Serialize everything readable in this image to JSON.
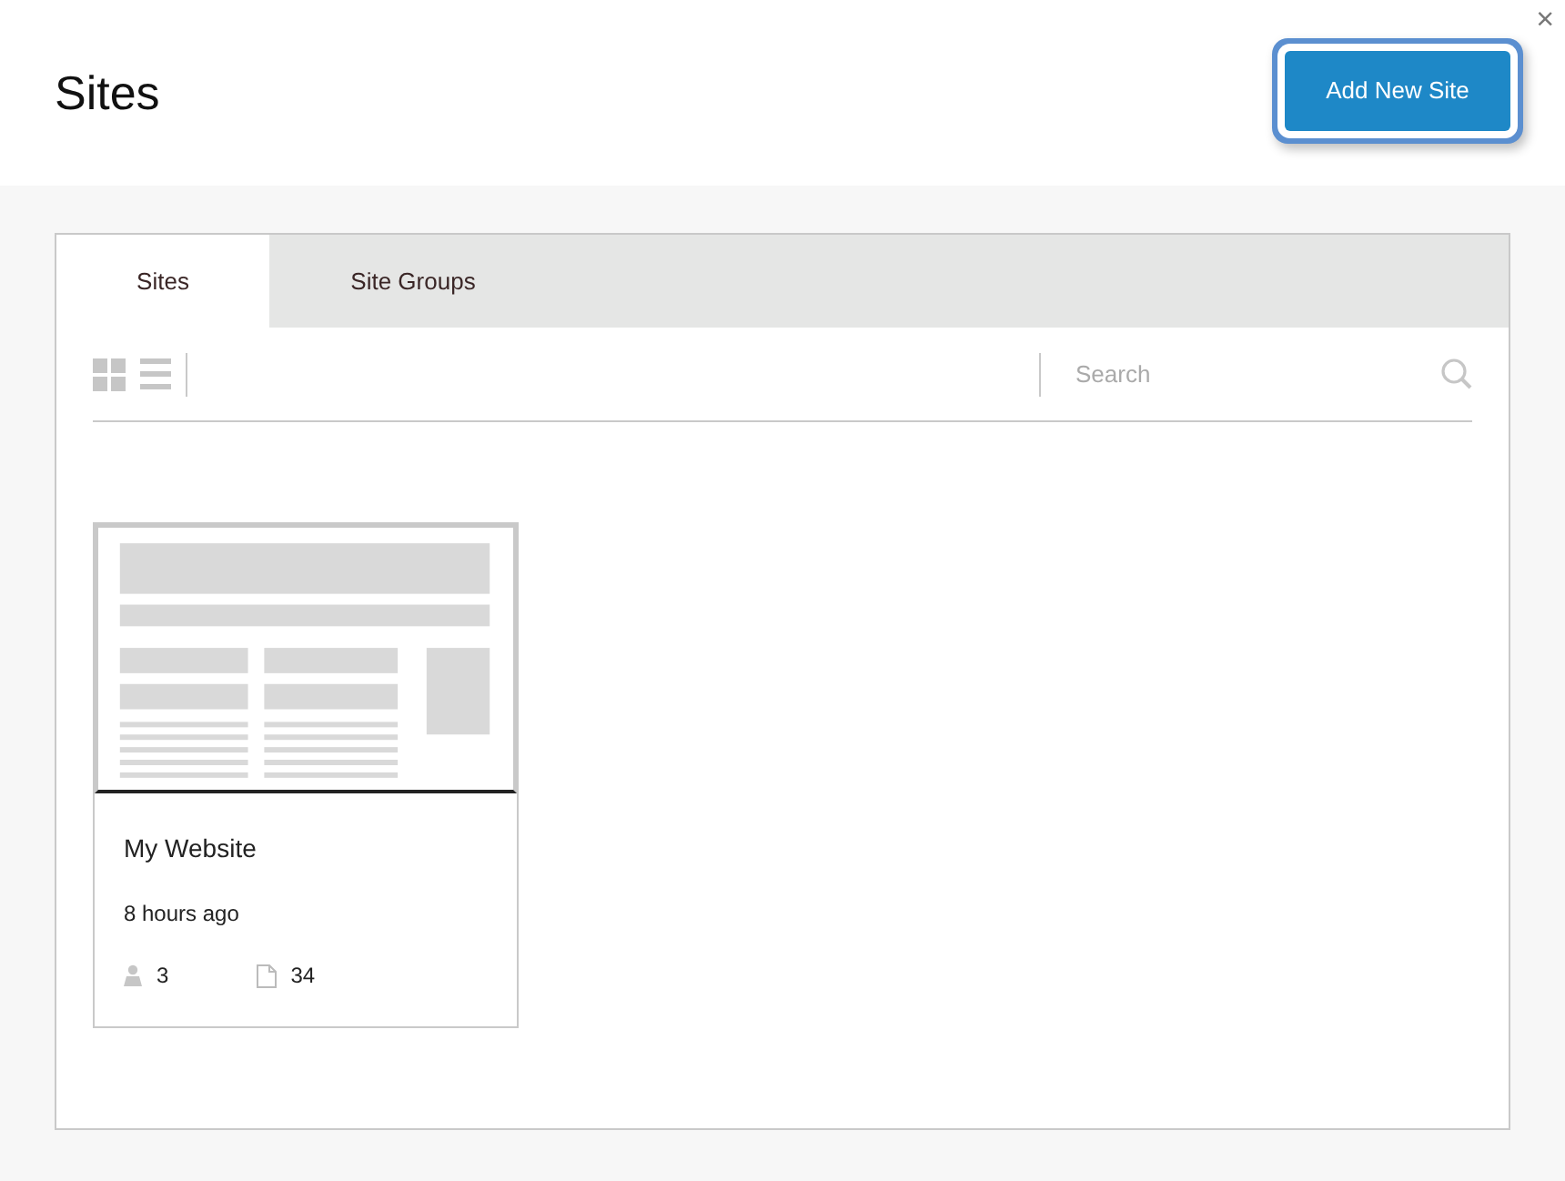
{
  "header": {
    "title": "Sites",
    "add_button": "Add New Site",
    "close": "×"
  },
  "tabs": [
    {
      "label": "Sites",
      "selected": true
    },
    {
      "label": "Site Groups",
      "selected": false
    }
  ],
  "search": {
    "placeholder": "Search"
  },
  "sites": [
    {
      "name": "My Website",
      "updated": "8 hours ago",
      "users": "3",
      "pages": "34"
    }
  ]
}
